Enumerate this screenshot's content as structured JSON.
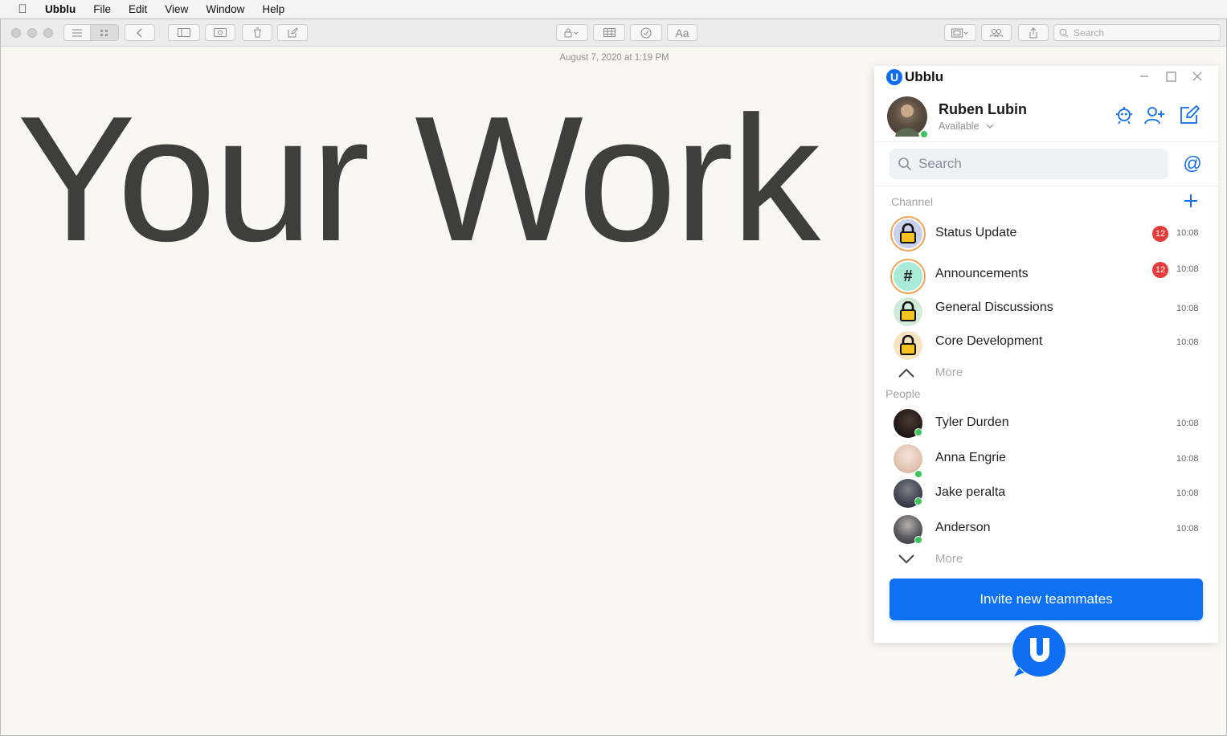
{
  "menubar": {
    "app_name": "Ubblu",
    "items": [
      "File",
      "Edit",
      "View",
      "Window",
      "Help"
    ]
  },
  "notes_window": {
    "search_placeholder": "Search",
    "font_button_label": "Aa",
    "date": "August 7, 2020 at 1:19 PM",
    "body_text": "Your Work"
  },
  "ubblu": {
    "brand": "Ubblu",
    "logo_letter": "U",
    "user": {
      "name": "Ruben Lubin",
      "status": "Available"
    },
    "search_placeholder": "Search",
    "mention_symbol": "@",
    "channel_section": "Channel",
    "channels": [
      {
        "name": "Status Update",
        "badge": "12",
        "time": "10:08",
        "icon": "lock-icon"
      },
      {
        "name": "Announcements",
        "badge": "12",
        "time": "10:08",
        "icon": "hash-icon",
        "symbol": "#"
      },
      {
        "name": "General Discussions",
        "badge": "",
        "time": "10:08",
        "icon": "lock-icon"
      },
      {
        "name": "Core Development",
        "badge": "",
        "time": "10:08",
        "icon": "lock-icon"
      }
    ],
    "channels_more": "More",
    "people_section": "People",
    "people": [
      {
        "name": "Tyler Durden",
        "time": "10:08"
      },
      {
        "name": "Anna Engrie",
        "time": "10:08"
      },
      {
        "name": "Jake peralta",
        "time": "10:08"
      },
      {
        "name": "Anderson",
        "time": "10:08"
      }
    ],
    "people_more": "More",
    "invite_button": "Invite new teammates",
    "colors": {
      "accent": "#0e6df0",
      "badge": "#e43b3b",
      "online": "#3cc35b",
      "ring": "#f3a353"
    }
  }
}
